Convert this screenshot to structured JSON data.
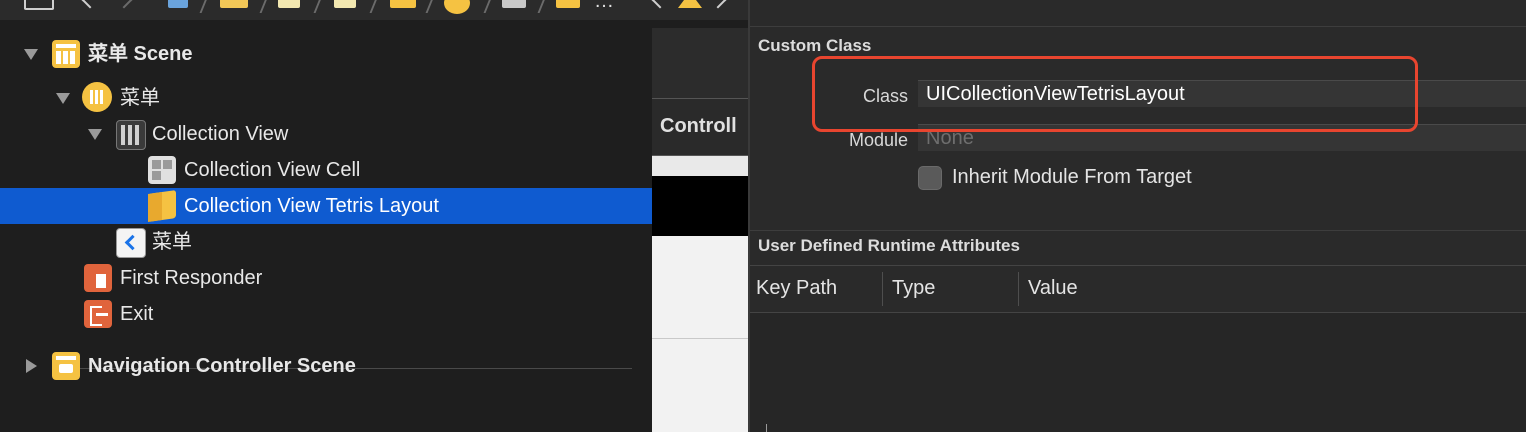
{
  "outline": {
    "menu_scene_label": "菜单 Scene",
    "menu_controller_label": "菜单",
    "collection_view_label": "Collection View",
    "collection_view_cell_label": "Collection View Cell",
    "tetris_layout_label": "Collection View Tetris Layout",
    "nav_item_label": "菜单",
    "first_responder_label": "First Responder",
    "exit_label": "Exit",
    "nav_controller_scene_label": "Navigation Controller Scene"
  },
  "jumpbar": {
    "ellipsis": "…"
  },
  "canvas": {
    "partial_title": "Controll"
  },
  "inspector": {
    "custom_class": {
      "title": "Custom Class",
      "class_label": "Class",
      "class_value": "UICollectionViewTetrisLayout",
      "module_label": "Module",
      "module_placeholder": "None",
      "inherit_label": "Inherit Module From Target"
    },
    "runtime_attributes": {
      "title": "User Defined Runtime Attributes",
      "columns": [
        "Key Path",
        "Type",
        "Value"
      ]
    }
  },
  "colors": {
    "selection": "#0f5bd0",
    "highlight_box": "#e8452f",
    "scene_icon": "#f5c242",
    "layout_icon": "#f5c242",
    "first_responder_icon": "#e0643c",
    "exit_icon": "#e0643c"
  }
}
